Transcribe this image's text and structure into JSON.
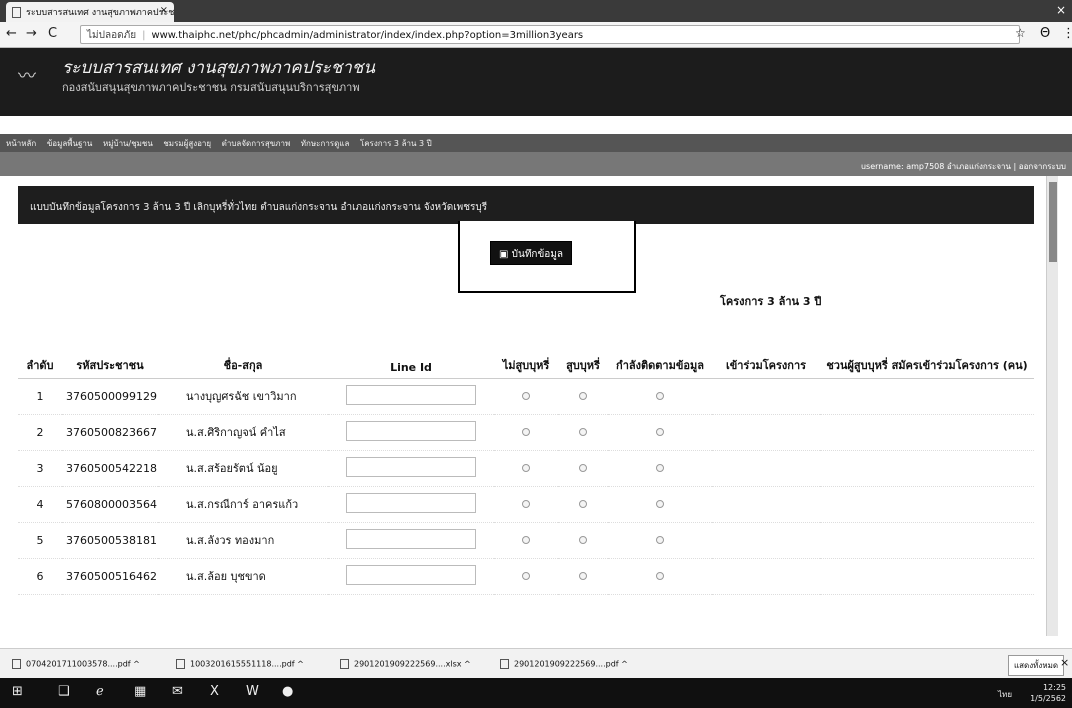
{
  "browser": {
    "tab_title": "ระบบสารสนเทศ งานสุขภาพภาคประชาชน",
    "tab_close": "×",
    "window_close": "×",
    "security_label": "ไม่ปลอดภัย",
    "url": "www.thaiphc.net/phc/phcadmin/administrator/index/index.php?option=3million3years",
    "back": "←",
    "forward": "→",
    "reload": "C",
    "star": "☆",
    "account": "Θ",
    "menu": "⋮"
  },
  "site": {
    "logo": "〰",
    "title": "ระบบสารสนเทศ งานสุขภาพภาคประชาชน",
    "subtitle": "กองสนับสนุนสุขภาพภาคประชาชน กรมสนับสนุนบริการสุขภาพ",
    "menu_items": [
      "หน้าหลัก",
      "ข้อมูลพื้นฐาน",
      "หมู่บ้าน/ชุมชน",
      "ชมรมผู้สูงอายุ",
      "ตำบลจัดการสุขภาพ",
      "ทักษะการดูแล",
      "โครงการ 3 ล้าน 3 ปี"
    ],
    "user_info": "username: amp7508 อำเภอแก่งกระจาน | ออกจากระบบ"
  },
  "form": {
    "header": "แบบบันทึกข้อมูลโครงการ 3 ล้าน 3 ปี เลิกบุหรี่ทั่วไทย ตำบลแก่งกระจาน อำเภอแก่งกระจาน จังหวัดเพชรบุรี",
    "save_button": "บันทึกข้อมูล",
    "project_title": "โครงการ 3 ล้าน 3 ปี"
  },
  "table": {
    "headers": [
      "ลำดับ",
      "รหัสประชาชน",
      "ชื่อ-สกุล",
      "Line Id",
      "ไม่สูบบุหรี่",
      "สูบบุหรี่",
      "กำลังติดตามข้อมูล",
      "เข้าร่วมโครงการ",
      "ชวนผู้สูบบุหรี่ สมัครเข้าร่วมโครงการ (คน)"
    ],
    "rows": [
      {
        "no": "1",
        "id": "3760500099129",
        "name": "นางบุญศรฉัช เขาวิมาก"
      },
      {
        "no": "2",
        "id": "3760500823667",
        "name": "น.ส.ศิริกาญจน์ คำไส"
      },
      {
        "no": "3",
        "id": "3760500542218",
        "name": "น.ส.สร้อยรัตน์ น้อยู"
      },
      {
        "no": "4",
        "id": "5760800003564",
        "name": "น.ส.กรณีการ์ อาครแก้ว"
      },
      {
        "no": "5",
        "id": "3760500538181",
        "name": "น.ส.ลังวร ทองมาก"
      },
      {
        "no": "6",
        "id": "3760500516462",
        "name": "น.ส.ล้อย บุชขาด"
      }
    ]
  },
  "downloads": {
    "items": [
      {
        "name": "0704201711003578....pdf"
      },
      {
        "name": "1003201615551118....pdf"
      },
      {
        "name": "2901201909222569....xlsx"
      },
      {
        "name": "2901201909222569....pdf"
      }
    ],
    "chevron": "^",
    "show_all": "แสดงทั้งหมด",
    "close": "×"
  },
  "taskbar": {
    "start": "⊞",
    "icons": [
      "❑",
      "ℯ",
      "▦",
      "✉",
      "X",
      "W",
      "●"
    ],
    "time": "12:25",
    "date": "1/5/2562",
    "lang": "ไทย"
  }
}
